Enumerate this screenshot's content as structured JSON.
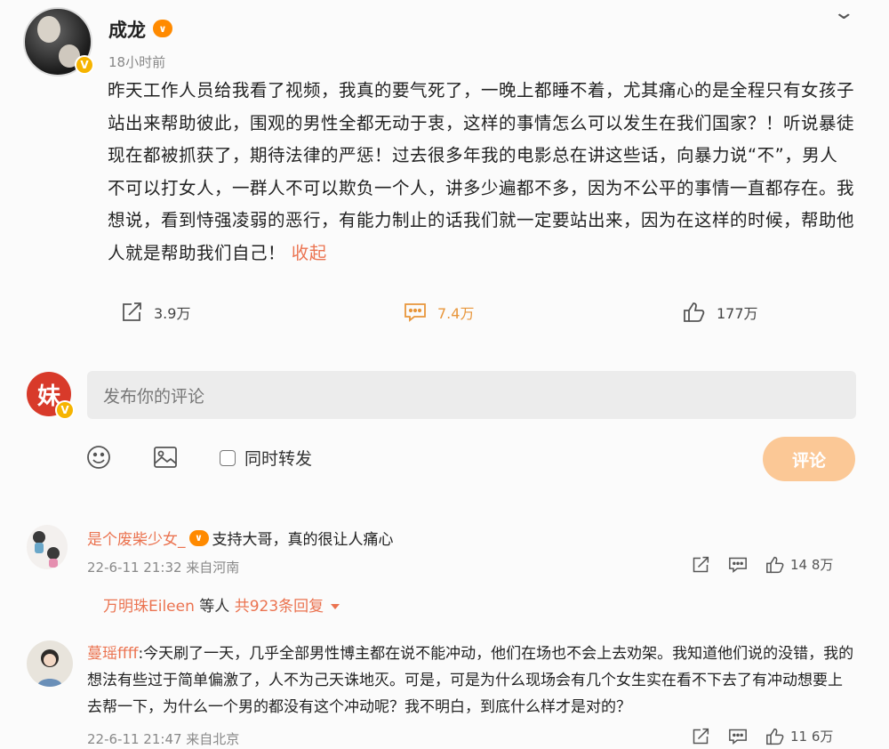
{
  "post": {
    "author": "成龙",
    "author_badge_icon": "level-badge-icon",
    "verified_icon": "verified-v-icon",
    "time": "18小时前",
    "text": "昨天工作人员给我看了视频，我真的要气死了，一晚上都睡不着，尤其痛心的是全程只有女孩子站出来帮助彼此，围观的男性全都无动于衷，这样的事情怎么可以发生在我们国家？！听说暴徒现在都被抓获了，期待法律的严惩！过去很多年我的电影总在讲这些话，向暴力说“不”，男人不可以打女人，一群人不可以欺负一个人，讲多少遍都不多，因为不公平的事情一直都存在。我想说，看到恃强凌弱的恶行，有能力制止的话我们就一定要站出来，因为在这样的时候，帮助他人就是帮助我们自己！",
    "collapse_label": "收起",
    "actions": {
      "share": "3.9万",
      "comment": "7.4万",
      "like": "177万"
    }
  },
  "composer": {
    "my_avatar_char": "妹",
    "placeholder": "发布你的评论",
    "repost_label": "同时转发",
    "submit_label": "评论"
  },
  "comments": [
    {
      "user": "是个废柴少女_",
      "text": "支持大哥，真的很让人痛心",
      "time": "22-6-11 21:32 来自河南",
      "likes": "14 8万",
      "replies_users": "万明珠Eileen",
      "replies_mid": "等人",
      "replies_count": "共923条回复"
    },
    {
      "user": "蔓瑶ffff",
      "text": ":今天刷了一天，几乎全部男性博主都在说不能冲动，他们在场也不会上去劝架。我知道他们说的没错，我的想法有些过于简单偏激了，人不为己天诛地灭。可是，可是为什么现场会有几个女生实在看不下去了有冲动想要上去帮一下，为什么一个男的都没有这个冲动呢？我不明白，到底什么样才是对的？",
      "time": "22-6-11 21:47 来自北京",
      "likes": "11 6万"
    }
  ],
  "colors": {
    "accent": "#eb7350",
    "comment_accent": "#e8963b",
    "submit_bg": "#fbc896",
    "badge": "#ff8a00",
    "verified": "#f6b400"
  }
}
